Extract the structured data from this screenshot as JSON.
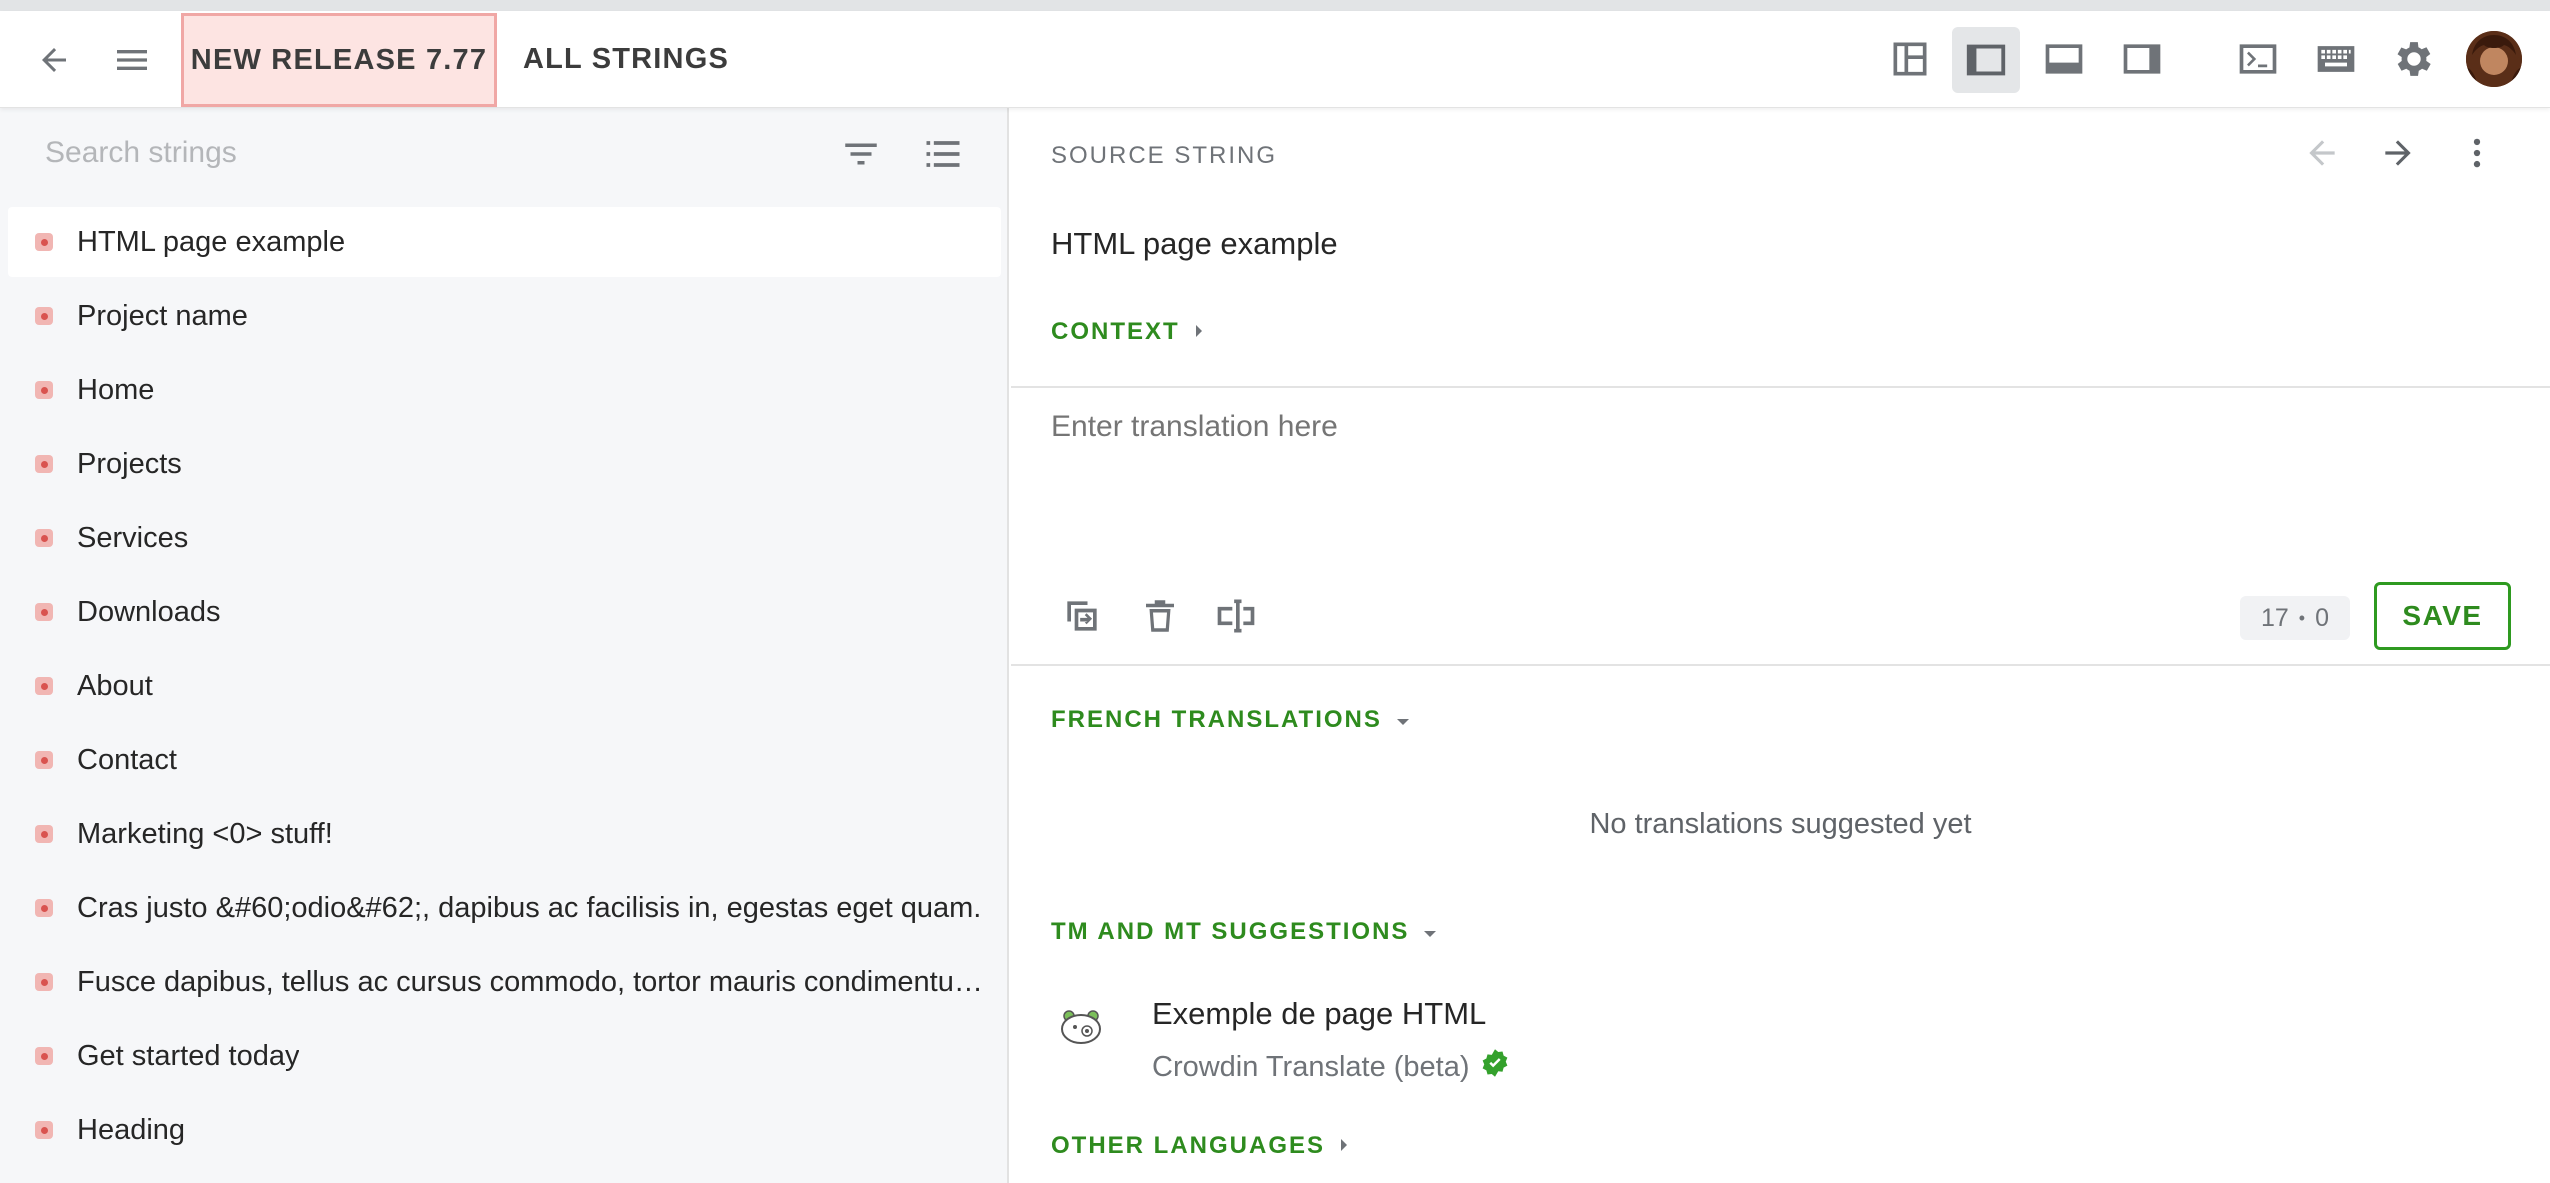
{
  "topbar": {
    "release_label": "NEW RELEASE 7.77",
    "all_strings_label": "ALL STRINGS",
    "icons": [
      "back-arrow-icon",
      "menu-icon",
      "layout-side-by-side-icon",
      "layout-sidebar-icon",
      "layout-bottom-icon",
      "layout-right-panel-icon",
      "terminal-icon",
      "keyboard-icon",
      "gear-icon",
      "avatar"
    ]
  },
  "sidebar": {
    "search_placeholder": "Search strings",
    "items": [
      {
        "label": "HTML page example",
        "active": true
      },
      {
        "label": "Project name"
      },
      {
        "label": "Home"
      },
      {
        "label": "Projects"
      },
      {
        "label": "Services"
      },
      {
        "label": "Downloads"
      },
      {
        "label": "About"
      },
      {
        "label": "Contact"
      },
      {
        "label": "Marketing <0> stuff!"
      },
      {
        "label": "Cras justo &#60;odio&#62;, dapibus ac facilisis in, egestas eget quam."
      },
      {
        "label": "Fusce dapibus, tellus ac cursus commodo, tortor mauris condimentum nibh, ut fermentum massa justo sit amet risus."
      },
      {
        "label": "Get started today"
      },
      {
        "label": "Heading"
      }
    ]
  },
  "editor": {
    "source_label": "SOURCE STRING",
    "source_text": "HTML page example",
    "context_label": "CONTEXT",
    "translation_placeholder": "Enter translation here",
    "counter_left": "17",
    "counter_sep": "•",
    "counter_right": "0",
    "save_label": "SAVE",
    "translations_label": "FRENCH TRANSLATIONS",
    "no_translations": "No translations suggested yet",
    "tm_label": "TM AND MT SUGGESTIONS",
    "suggestion": {
      "text": "Exemple de page HTML",
      "source": "Crowdin Translate (beta)"
    },
    "other_languages_label": "OTHER LANGUAGES"
  },
  "colors": {
    "accent_green": "#2e8b1e",
    "release_bg": "#fde4e2",
    "release_border": "#f0a7a5",
    "status_untranslated": "#d9534f"
  }
}
